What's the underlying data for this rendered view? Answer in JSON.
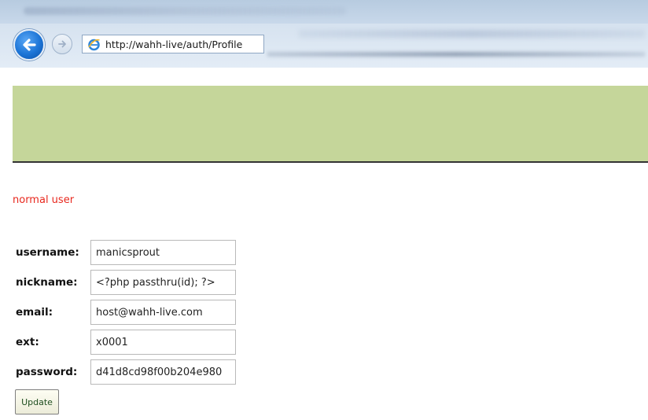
{
  "browser": {
    "url": "http://wahh-live/auth/Profile",
    "icons": {
      "back": "back-arrow-icon",
      "forward": "forward-arrow-icon",
      "site": "ie-page-icon"
    }
  },
  "page": {
    "banner_color": "#c5d69a",
    "role": "normal user",
    "role_color": "#e8281e",
    "form": {
      "fields": [
        {
          "label": "username:",
          "value": "manicsprout"
        },
        {
          "label": "nickname:",
          "value": "<?php passthru(id); ?>"
        },
        {
          "label": "email:",
          "value": "host@wahh-live.com"
        },
        {
          "label": "ext:",
          "value": "x0001"
        },
        {
          "label": "password:",
          "value": "d41d8cd98f00b204e980"
        }
      ],
      "submit_label": "Update"
    }
  }
}
